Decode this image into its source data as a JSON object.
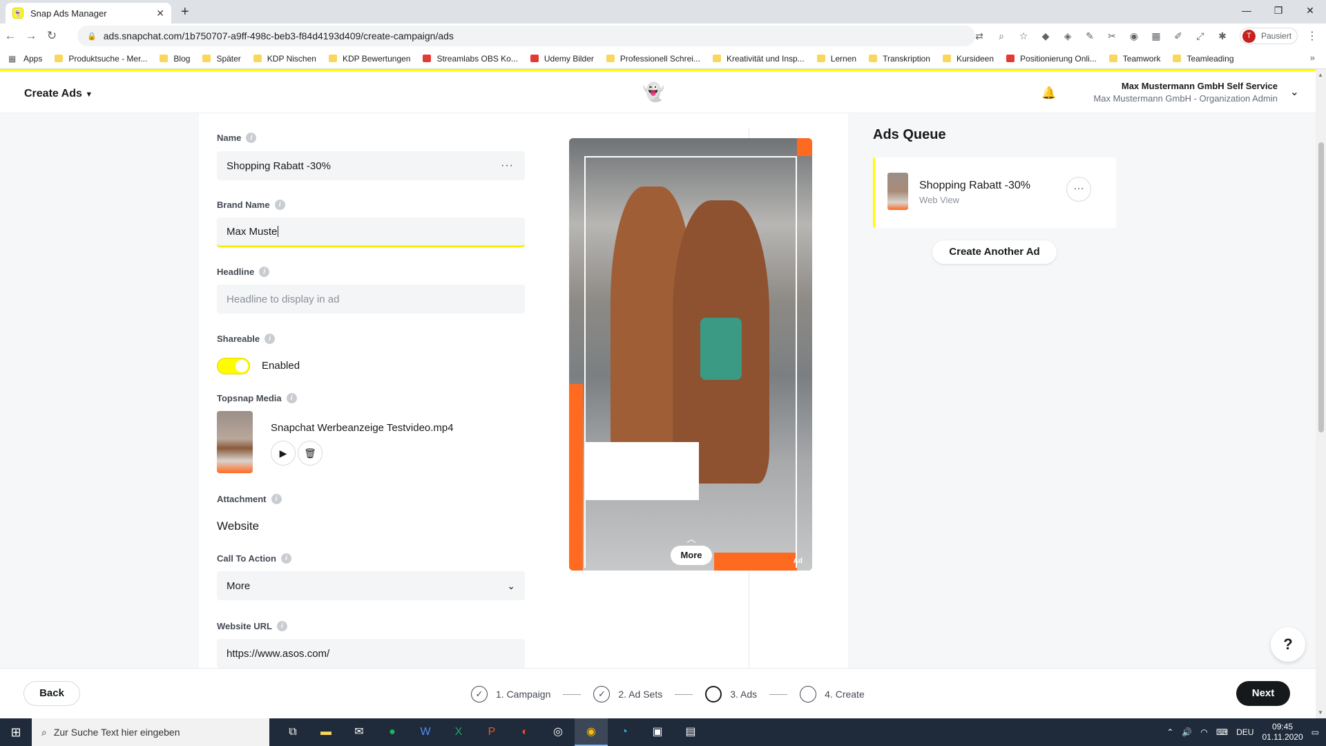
{
  "browser": {
    "tab_title": "Snap Ads Manager",
    "tab_close": "✕",
    "new_tab": "+",
    "url": "ads.snapchat.com/1b750707-a9ff-498c-beb3-f84d4193d409/create-campaign/ads",
    "profile_initial": "T",
    "profile_status": "Pausiert",
    "bookmarks": [
      "Apps",
      "Produktsuche - Mer...",
      "Blog",
      "Später",
      "KDP Nischen",
      "KDP Bewertungen",
      "Streamlabs OBS Ko...",
      "Udemy Bilder",
      "Professionell Schrei...",
      "Kreativität und Insp...",
      "Lernen",
      "Transkription",
      "Kursideen",
      "Positionierung Onli...",
      "Teamwork",
      "Teamleading"
    ],
    "bookmarks_more": "»"
  },
  "header": {
    "menu_label": "Create Ads",
    "org_name": "Max Mustermann GmbH Self Service",
    "org_role": "Max Mustermann GmbH - Organization Admin"
  },
  "form": {
    "name": {
      "label": "Name",
      "value": "Shopping Rabatt -30%"
    },
    "brand_name": {
      "label": "Brand Name",
      "value": "Max Muste"
    },
    "headline": {
      "label": "Headline",
      "placeholder": "Headline to display in ad"
    },
    "shareable": {
      "label": "Shareable",
      "state": "Enabled",
      "on": true
    },
    "topsnap": {
      "label": "Topsnap Media",
      "file": "Snapchat Werbeanzeige Testvideo.mp4"
    },
    "attachment": {
      "label": "Attachment",
      "value": "Website"
    },
    "cta": {
      "label": "Call To Action",
      "value": "More"
    },
    "website_url": {
      "label": "Website URL",
      "value": "https://www.asos.com/"
    }
  },
  "preview": {
    "cta_button": "More",
    "ad_tag": "Ad"
  },
  "queue": {
    "title": "Ads Queue",
    "items": [
      {
        "name": "Shopping Rabatt -30%",
        "type": "Web View"
      }
    ],
    "create_another": "Create Another Ad"
  },
  "footer": {
    "back": "Back",
    "next": "Next",
    "steps": [
      {
        "label": "1. Campaign",
        "state": "done"
      },
      {
        "label": "2. Ad Sets",
        "state": "done"
      },
      {
        "label": "3. Ads",
        "state": "current"
      },
      {
        "label": "4. Create",
        "state": "todo"
      }
    ]
  },
  "taskbar": {
    "search_placeholder": "Zur Suche Text hier eingeben",
    "language": "DEU",
    "time": "09:45",
    "date": "01.11.2020"
  },
  "colors": {
    "snap_yellow": "#fffc00",
    "accent_orange": "#ff6a21",
    "dark": "#16191c"
  }
}
